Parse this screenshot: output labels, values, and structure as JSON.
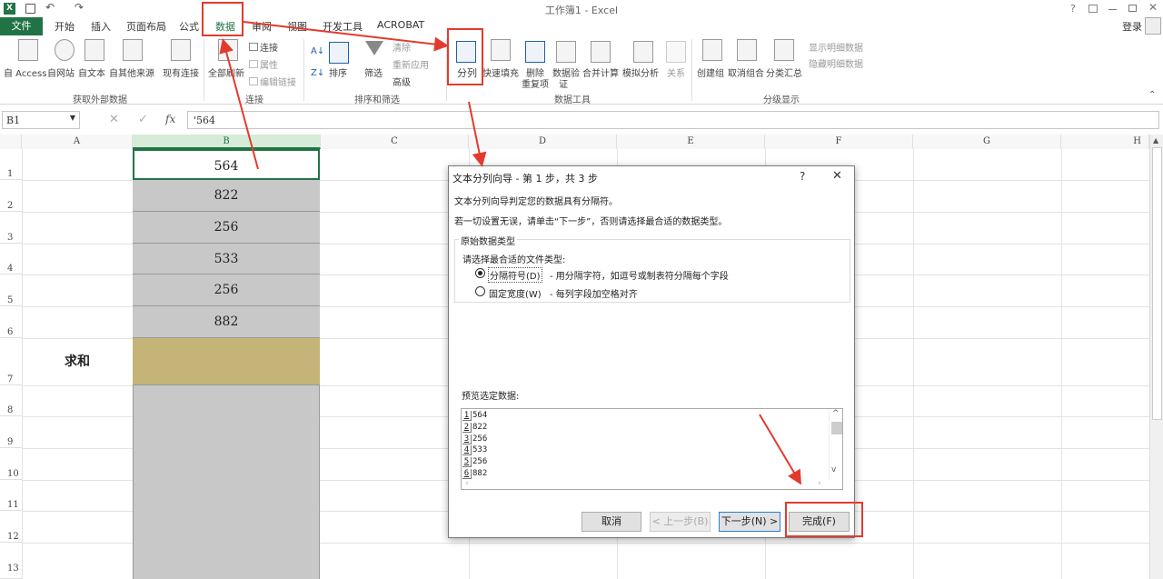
{
  "title": "工作簿1 - Excel",
  "title_right": "?",
  "login": "登录",
  "tabs": [
    "文件",
    "开始",
    "插入",
    "页面布局",
    "公式",
    "数据",
    "审阅",
    "视图",
    "开发工具",
    "ACROBAT"
  ],
  "ribbon": {
    "ext": {
      "access": "自 Access",
      "web": "自网站",
      "text": "自文本",
      "other": "自其他来源",
      "existing": "现有连接",
      "label": "获取外部数据"
    },
    "conn": {
      "refresh": "全部刷新",
      "connections": "连接",
      "props": "属性",
      "edit": "编辑链接",
      "label": "连接"
    },
    "sort": {
      "sort": "排序",
      "filter": "筛选",
      "clear": "清除",
      "reapply": "重新应用",
      "advanced": "高级",
      "label": "排序和筛选"
    },
    "tools": {
      "split": "分列",
      "flash": "快速填充",
      "dup1": "删除",
      "dup2": "重复项",
      "valid1": "数据验",
      "valid2": "证",
      "consol": "合并计算",
      "whatif": "模拟分析",
      "rel": "关系",
      "label": "数据工具"
    },
    "outline": {
      "group": "创建组",
      "ungroup": "取消组合",
      "subtotal": "分类汇总",
      "show": "显示明细数据",
      "hide": "隐藏明细数据",
      "label": "分级显示"
    }
  },
  "namebox": "B1",
  "formula": "'564",
  "fx": "fx",
  "columns": [
    "A",
    "B",
    "C",
    "D",
    "E",
    "F",
    "G",
    "H"
  ],
  "rows": [
    "1",
    "2",
    "3",
    "4",
    "5",
    "6",
    "7",
    "8",
    "9",
    "10",
    "11",
    "12",
    "13"
  ],
  "colB_values": [
    "564",
    "822",
    "256",
    "533",
    "256",
    "882"
  ],
  "sum_label": "求和",
  "dialog": {
    "title": "文本分列向导 - 第 1 步，共 3 步",
    "help": "?",
    "close": "✕",
    "line1": "文本分列向导判定您的数据具有分隔符。",
    "line2": "若一切设置无误，请单击“下一步”，否则请选择最合适的数据类型。",
    "group_title": "原始数据类型",
    "choose": "请选择最合适的文件类型:",
    "opt1": "分隔符号(D)",
    "opt1_desc": "- 用分隔字符，如逗号或制表符分隔每个字段",
    "opt2": "固定宽度(W)",
    "opt2_desc": "- 每列字段加空格对齐",
    "preview_label": "预览选定数据:",
    "preview": [
      {
        "n": "1",
        "v": "564"
      },
      {
        "n": "2",
        "v": "822"
      },
      {
        "n": "3",
        "v": "256"
      },
      {
        "n": "4",
        "v": "533"
      },
      {
        "n": "5",
        "v": "256"
      },
      {
        "n": "6",
        "v": "882"
      }
    ],
    "cancel": "取消",
    "back": "< 上一步(B)",
    "next": "下一步(N) >",
    "finish": "完成(F)"
  },
  "colors": {
    "excel_green": "#217346",
    "accent_red": "#e23b2e",
    "selected_gray": "#c8c8c8",
    "sum_cell": "#c4b478"
  }
}
